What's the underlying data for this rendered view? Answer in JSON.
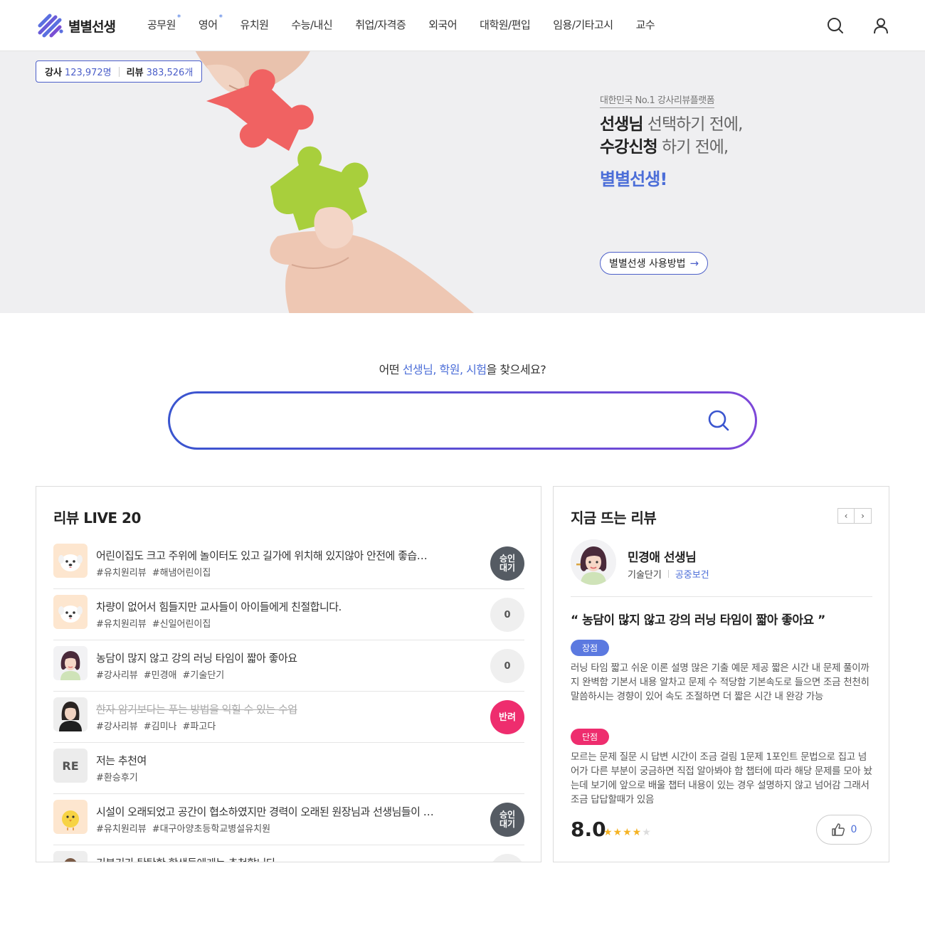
{
  "header": {
    "logo_text": "별별선생",
    "nav": [
      {
        "label": "공무원",
        "star": "*"
      },
      {
        "label": "영어",
        "star": "*"
      },
      {
        "label": "유치원",
        "star": ""
      },
      {
        "label": "수능/내신",
        "star": ""
      },
      {
        "label": "취업/자격증",
        "star": ""
      },
      {
        "label": "외국어",
        "star": ""
      },
      {
        "label": "대학원/편입",
        "star": ""
      },
      {
        "label": "임용/기타고시",
        "star": ""
      },
      {
        "label": "교수",
        "star": ""
      }
    ]
  },
  "hero": {
    "stats": {
      "teacher_label": "강사",
      "teacher_count": "123,972명",
      "review_label": "리뷰",
      "review_count": "383,526개"
    },
    "tag": "대한민국 No.1 강사리뷰플랫폼",
    "line1_strong": "선생님",
    "line1_rest": " 선택하기 전에,",
    "line2_strong": "수강신청",
    "line2_rest": " 하기 전에,",
    "brand": "별별선생!",
    "button": "별별선생 사용방법",
    "button_arrow": "→"
  },
  "search": {
    "question_prefix": "어떤 ",
    "q1": "선생님",
    "comma1": ", ",
    "q2": "학원",
    "comma2": ", ",
    "q3": "시험",
    "question_suffix": "을 찾으세요?",
    "placeholder": ""
  },
  "live": {
    "title": "리뷰 LIVE 20",
    "rows": [
      {
        "title": "어린이집도 크고 주위에 놀이터도 있고 길가에 위치해 있지않아 안전에 좋습…",
        "tags": [
          "#유치원리뷰",
          "#해냄어린이집"
        ],
        "badge": "승인\n대기",
        "badge_type": "dark",
        "avatar": "dog",
        "strike": false
      },
      {
        "title": "차량이 없어서 힘들지만 교사들이 아이들에게 친절합니다.",
        "tags": [
          "#유치원리뷰",
          "#신일어린이집"
        ],
        "badge": "0",
        "badge_type": "zero",
        "avatar": "dog",
        "strike": false
      },
      {
        "title": "농담이 많지 않고 강의 러닝 타임이 짧아 좋아요",
        "tags": [
          "#강사리뷰",
          "#민경애",
          "#기술단기"
        ],
        "badge": "0",
        "badge_type": "zero",
        "avatar": "woman",
        "strike": false
      },
      {
        "title": "한자 암기보다는 푸는 방법을 익힐 수 있는 수업",
        "tags": [
          "#강사리뷰",
          "#김미나",
          "#파고다"
        ],
        "badge": "반려",
        "badge_type": "red",
        "avatar": "photo",
        "strike": true
      },
      {
        "title": "저는 추천여",
        "tags": [
          "#환승후기"
        ],
        "badge": "",
        "badge_type": "none",
        "avatar": "RE",
        "strike": false
      },
      {
        "title": "시설이 오래되었고 공간이 협소하였지만 경력이 오래된 원장님과 선생님들이 …",
        "tags": [
          "#유치원리뷰",
          "#대구아양초등학교병설유치원"
        ],
        "badge": "승인\n대기",
        "badge_type": "dark",
        "avatar": "chick",
        "strike": false
      },
      {
        "title": "기본기가 탄탄한 학생들에게는 추천합니다",
        "tags": [],
        "badge": "",
        "badge_type": "zero",
        "avatar": "man",
        "strike": false
      }
    ]
  },
  "hot": {
    "title": "지금 뜨는 리뷰",
    "prev": "‹",
    "next": "›",
    "teacher_name": "민경애 선생님",
    "academy": "기술단기",
    "subject": "공중보건",
    "quote": "“ 농담이 많지 않고 강의 러닝 타임이 짧아 좋아요 ”",
    "pro_label": "장점",
    "pro_text": "러닝 타임 짧고 쉬운 이론 설명 많은 기출 예문 제공 짧은 시간 내 문제 풀이까지 완벽함 기본서 내용 알차고 문제 수 적당함 기본속도로 들으면 조금 천천히 말씀하시는 경향이 있어 속도 조절하면 더 짧은 시간 내 완강 가능",
    "con_label": "단점",
    "con_text": "모르는 문제 질문 시 답변 시간이 조금 걸림 1문제 1포인트 문법으로 집고 넘어가 다른 부분이 궁금하면 직접 알아봐야 함 챕터에 따라 해당 문제를 모아 놨는데 보기에 앞으로 배울 챕터 내용이 있는 경우 설명하지 않고 넘어감 그래서 조금 답답할때가 있음",
    "score": "8.0",
    "stars_on": "★★★★",
    "stars_off": "★",
    "likes": "0"
  },
  "colors": {
    "accent": "#4c5fc9",
    "brand_blue": "#4c6ed8",
    "reject": "#ee2d6e",
    "pending": "#555b63",
    "star": "#f5b324"
  }
}
